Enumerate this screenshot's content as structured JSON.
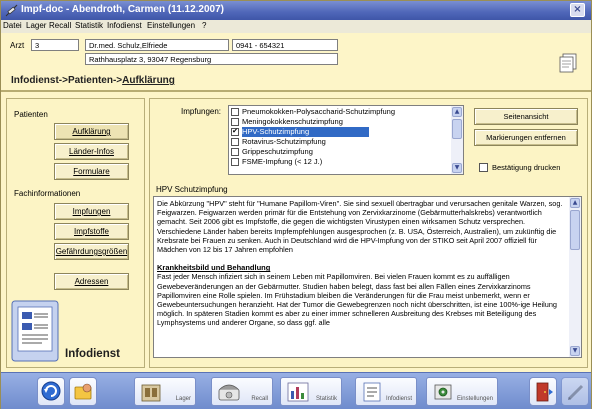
{
  "window": {
    "title": "Impf-doc - Abendroth, Carmen (11.12.2007)",
    "close_glyph": "×"
  },
  "menu": [
    "Datei",
    "Lager",
    "Recall",
    "Statistik",
    "Infodienst",
    "Einstellungen",
    "?"
  ],
  "patient": {
    "arzt_label": "Arzt",
    "arzt_value": "3",
    "doctor_name": "Dr.med. Schulz,Elfriede",
    "phone": "0941 - 654321",
    "address": "Rathhausplatz 3, 93047 Regensburg"
  },
  "breadcrumb": {
    "prefix": "Infodienst->Patienten->",
    "current": "Aufklärung"
  },
  "sidebar": {
    "patienten_title": "Patienten",
    "patienten_buttons": [
      "Aufklärung",
      "Länder-Infos",
      "Formulare"
    ],
    "fach_title": "Fachinformationen",
    "fach_buttons": [
      "Impfungen",
      "Impfstoffe",
      "Gefährdungsgrößen"
    ],
    "adressen_button": "Adressen",
    "logo_text": "Infodienst"
  },
  "main": {
    "impfungen_label": "Impfungen:",
    "impfungen": [
      {
        "label": "Pneumokokken-Polysaccharid-Schutzimpfung",
        "checked": false,
        "selected": false
      },
      {
        "label": "Meningokokkenschutzimpfung",
        "checked": false,
        "selected": false
      },
      {
        "label": "HPV-Schutzimpfung",
        "checked": true,
        "selected": true
      },
      {
        "label": "Rotavirus-Schutzimpfung",
        "checked": false,
        "selected": false
      },
      {
        "label": "Grippeschutzimpfung",
        "checked": false,
        "selected": false
      },
      {
        "label": "FSME-Impfung (< 12 J.)",
        "checked": false,
        "selected": false
      }
    ],
    "seitenansicht_button": "Seitenansicht",
    "markierungen_button": "Markierungen entfernen",
    "bestaetigung_label": "Bestätigung drucken",
    "text_title": "HPV Schutzimpfung",
    "text_para1": "Die Abkürzung \"HPV\" steht für \"Humane Papillom-Viren\". Sie sind sexuell übertragbar und verursachen genitale Warzen, sog. Feigwarzen. Feigwarzen werden primär für die Entstehung von Zervixkarzinome (Gebärmutterhalskrebs) verantwortlich gemacht. Seit 2006 gibt es Impfstoffe, die gegen die wichtigsten Virustypen einen wirksamen Schutz versprechen. Verschiedene Länder haben bereits Impfempfehlungen ausgesprochen (z. B. USA, Österreich, Australien), um zukünftig die Krebsrate bei Frauen zu senken. Auch in Deutschland wird die HPV-Impfung von der STIKO seit April 2007 offiziell für Mädchen von 12 bis 17 Jahren empfohlen",
    "text_heading2": "Krankheitsbild und Behandlung",
    "text_para2": "Fast jeder Mensch infiziert sich in seinem Leben mit Papillomviren. Bei vielen Frauen kommt es zu auffälligen Gewebeveränderungen an der Gebärmutter. Studien haben belegt, dass fast bei allen Fällen eines Zervixkarzinoms Papillomviren eine Rolle spielen. Im Frühstadium bleiben die Veränderungen für die Frau meist unbemerkt, wenn er Gewebeuntersuchungen heranzieht. Hat der Tumor die Gewebegrenzen noch nicht überschritten, ist eine 100%-ige Heilung möglich. In späteren Stadien kommt es aber zu einer immer schnelleren Ausbreitung des Krebses mit Beteiligung des Lymphsystems und anderer Organe, so dass ggf. alle"
  },
  "toolbar": {
    "lager": "Lager",
    "recall": "Recall",
    "statistik": "Statistik",
    "infodienst": "Infodienst",
    "einstellungen": "Einstellungen"
  }
}
